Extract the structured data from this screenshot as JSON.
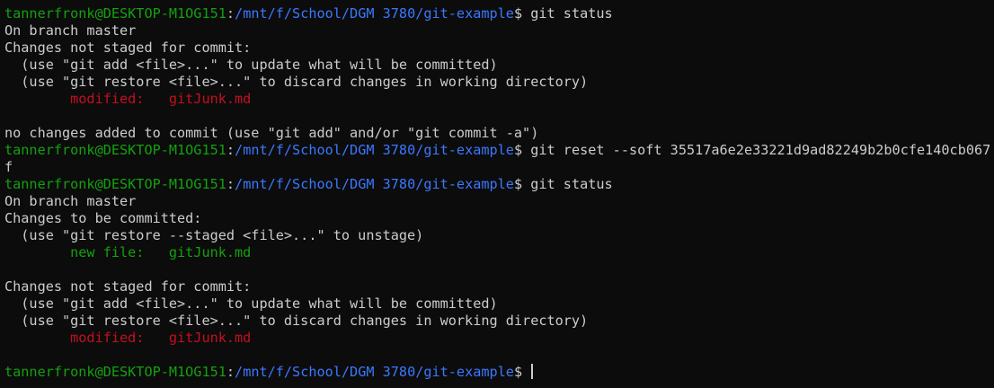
{
  "terminal": {
    "prompt": {
      "user_host": "tannerfronk@DESKTOP-M1OG151",
      "separator": ":",
      "path": "/mnt/f/School/DGM 3780/git-example",
      "symbol": "$ "
    },
    "commands": {
      "status1": "git status",
      "reset": "git reset --soft 35517a6e2e33221d9ad82249b2b0cfe140cb067",
      "reset_wrap": "f",
      "status2": "git status"
    },
    "output1": {
      "branch": "On branch master",
      "not_staged_header": "Changes not staged for commit:",
      "hint_add": "  (use \"git add <file>...\" to update what will be committed)",
      "hint_restore": "  (use \"git restore <file>...\" to discard changes in working directory)",
      "modified_label": "        modified:   ",
      "modified_file": "gitJunk.md",
      "blank": "",
      "no_changes": "no changes added to commit (use \"git add\" and/or \"git commit -a\")"
    },
    "output2": {
      "branch": "On branch master",
      "to_commit_header": "Changes to be committed:",
      "hint_unstage": "  (use \"git restore --staged <file>...\" to unstage)",
      "new_file_label": "        new file:   ",
      "new_file_name": "gitJunk.md",
      "blank": "",
      "not_staged_header": "Changes not staged for commit:",
      "hint_add": "  (use \"git add <file>...\" to update what will be committed)",
      "hint_restore": "  (use \"git restore <file>...\" to discard changes in working directory)",
      "modified_label": "        modified:   ",
      "modified_file": "gitJunk.md"
    },
    "colors": {
      "background": "#0c0c0c",
      "foreground": "#cccccc",
      "prompt_user": "#13a10e",
      "prompt_path": "#3b78ff",
      "modified": "#c50f1f",
      "new_file": "#13a10e"
    }
  }
}
